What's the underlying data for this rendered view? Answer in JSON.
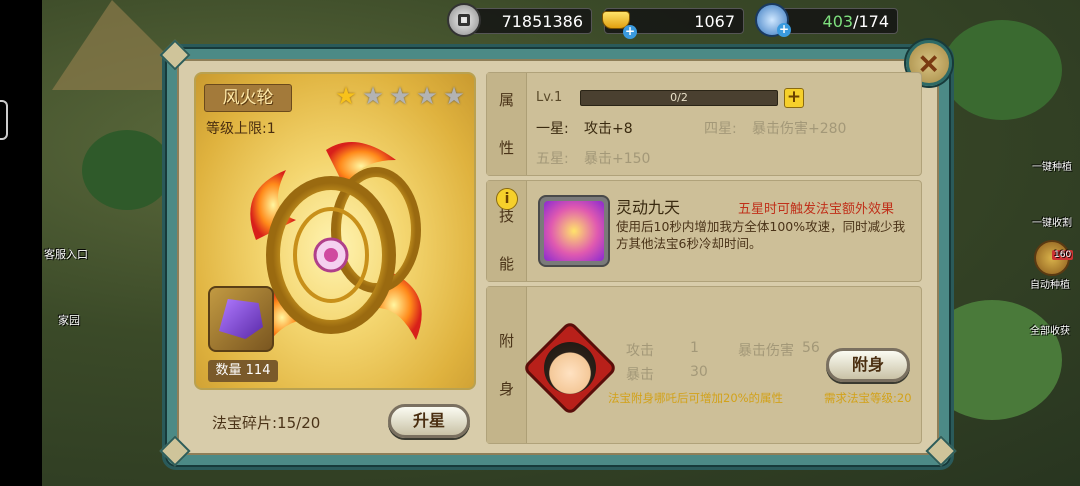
{
  "currency": {
    "coins": "71851386",
    "gold": "1067",
    "energy_current": "403",
    "energy_max": "/174",
    "coins_icon": "coin-icon",
    "gold_icon": "gold-ingot-icon",
    "energy_icon": "potion-icon"
  },
  "sidebar": {
    "service": "客服入口",
    "home": "家园",
    "right_items": [
      "一键种植",
      "一键收割",
      "自动种植",
      "全部收获"
    ],
    "badge": "160"
  },
  "treasure": {
    "name": "风火轮",
    "level_cap": "等级上限:1",
    "stars_total": 5,
    "stars_filled": 1,
    "quantity": "数量 114",
    "fragments": "法宝碎片:15/20",
    "upgrade_button": "升星"
  },
  "attributes": {
    "label_chars": [
      "属",
      "性"
    ],
    "level": "Lv.1",
    "progress_text": "0/2",
    "progress": 0,
    "rows": [
      {
        "star": "一星:",
        "value": "攻击+8",
        "active": true
      },
      {
        "star": "四星:",
        "value": "暴击伤害+280",
        "active": false
      },
      {
        "star": "五星:",
        "value": "暴击+150",
        "active": false
      }
    ]
  },
  "skill": {
    "label_chars": [
      "技",
      "能"
    ],
    "name": "灵动九天",
    "requirement": "五星时可触发法宝额外效果",
    "description": "使用后10秒内增加我方全体100%攻速，同时减少我方其他法宝6秒冷却时间。"
  },
  "attach": {
    "label_chars": [
      "附",
      "身"
    ],
    "stats": [
      {
        "name": "攻击",
        "value": "1"
      },
      {
        "name": "暴击伤害",
        "value": "56"
      },
      {
        "name": "暴击",
        "value": "30"
      }
    ],
    "bonus_note": "法宝附身哪吒后可增加20%的属性",
    "required_level": "需求法宝等级:20",
    "attach_button": "附身"
  },
  "colors": {
    "frame": "#4c8a86",
    "panel": "#cdbf98",
    "gold": "#f8c21a",
    "warning": "#c0301a",
    "note": "#d2a21a"
  }
}
